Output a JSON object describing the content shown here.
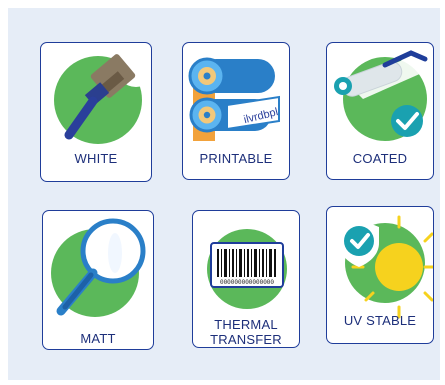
{
  "badges": [
    {
      "label": "WHITE"
    },
    {
      "label": "PRINTABLE"
    },
    {
      "label": "COATED"
    },
    {
      "label": "MATT"
    },
    {
      "label": "THERMAL\nTRANSFER"
    },
    {
      "label": "UV STABLE"
    }
  ],
  "barcode_text": "000000000000000",
  "roll_text": "ilvrdbpl",
  "colors": {
    "panel_bg": "#e6edf7",
    "card_border": "#1f3d9a",
    "label_text": "#1d2f7a",
    "green": "#5bb85a",
    "teal": "#1aa1b0",
    "roller_blue": "#2a7fc8",
    "sun_yellow": "#f6d21e"
  }
}
